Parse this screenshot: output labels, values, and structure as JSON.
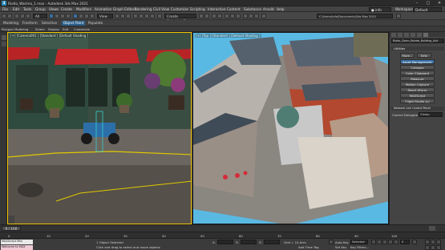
{
  "window": {
    "title": "Rialto_Warima_1.max - Autodesk 3ds Max 2021",
    "logo": "3"
  },
  "menu": [
    "File",
    "Edit",
    "Tools",
    "Group",
    "Views",
    "Create",
    "Modifiers",
    "Animation",
    "Graph Editors",
    "Rendering",
    "Civil View",
    "Customize",
    "Scripting",
    "Interactive",
    "Content",
    "Substance",
    "Arnold",
    "Help"
  ],
  "user": {
    "name": "info",
    "workspaces_label": "Workspaces:",
    "workspace": "Default",
    "path": "C:\\Users\\Info\\Documents\\3ds Max 2021"
  },
  "toolbar": {
    "selection_filter": "All",
    "view_dropdown": "View",
    "selection_set": "Create Selection Se"
  },
  "ribbon_tabs": [
    "Modeling",
    "Freeform",
    "Selection",
    "Object Paint",
    "Populate"
  ],
  "ribbon_active": "Object Paint",
  "subbar": [
    "Polygon Modeling"
  ],
  "scene_tabs": [
    "Select",
    "Display",
    "Edit",
    "Customize"
  ],
  "viewport_left": {
    "label": "[+] [Camera001 ] [Standard ] [Default Shading ]"
  },
  "viewport_right": {
    "label": "[+] [Top ] [Standard ] [Default Shading ]"
  },
  "command_panel": {
    "object_name": "Rialto_Zoom_Rotate_Building_Unit",
    "utilities_title": "Utilities",
    "top_buttons": [
      "More...",
      "Sets"
    ],
    "buttons": [
      "Asset Management",
      "Collapse",
      "Color Clipboard",
      "Measure",
      "Motion Capture",
      "Reset XForm",
      "MAXScript",
      "Flight Studio (c)"
    ],
    "rollout": "Network Link Control Panel",
    "rollout_row_label": "Control Delegate",
    "rollout_row_value": "Clamp"
  },
  "timeline": {
    "frame_display": "0 / 100",
    "ticks": [
      "0",
      "10",
      "20",
      "30",
      "40",
      "50",
      "60",
      "70",
      "80",
      "90",
      "100"
    ]
  },
  "status": {
    "script_line_1": "MAXScript Mini",
    "script_line_2": "Welcome to MAX",
    "selection": "1 Object Selected",
    "prompt": "Click and drag to select and move objects",
    "x_label": "X:",
    "y_label": "Y:",
    "z_label": "Z:",
    "grid": "Grid = 10,0cm",
    "add_time_tag": "Add Time Tag",
    "auto_key": "Auto Key",
    "set_key": "Set Key",
    "selected": "Selected",
    "key_filters": "Key Filters...",
    "frame": "0"
  },
  "colors": {
    "viewport_active_border": "#f2c200",
    "sky": "#55b8e0",
    "accent": "#3d73a8"
  }
}
